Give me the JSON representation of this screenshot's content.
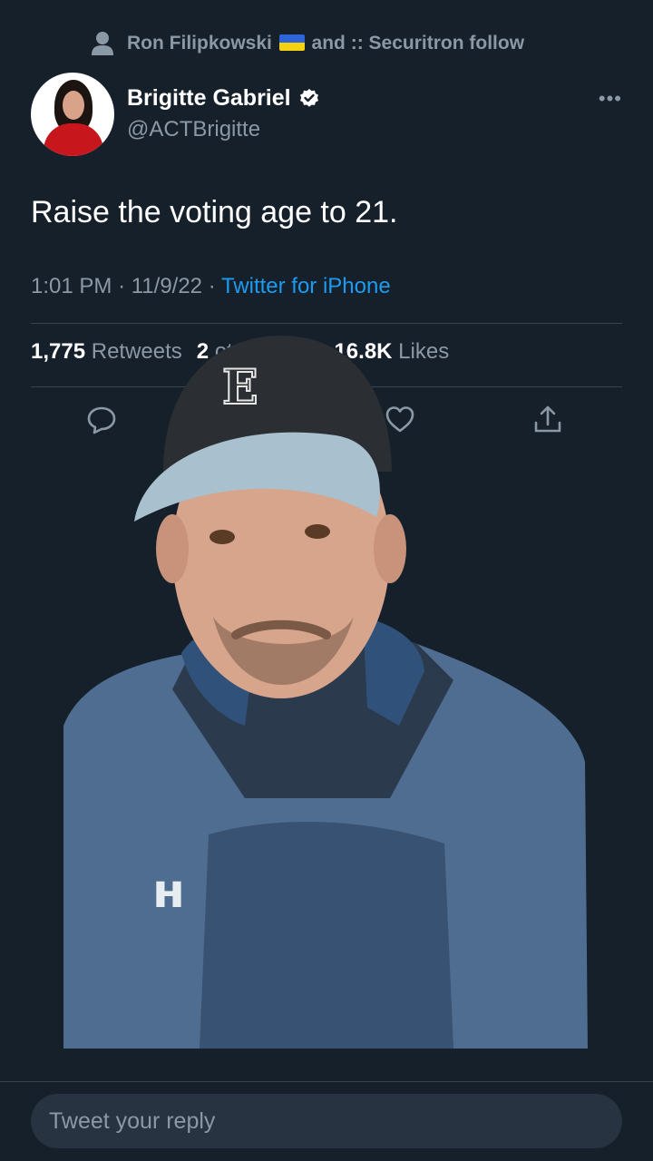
{
  "social_context": {
    "user": "Ron Filipkowski",
    "flag": "ukraine-flag",
    "text": "and :: Securitron follow"
  },
  "author": {
    "display_name": "Brigitte Gabriel",
    "handle": "@ACTBrigitte",
    "verified": true
  },
  "tweet": {
    "text": "Raise the voting age to 21.",
    "time": "1:01 PM",
    "date": "11/9/22",
    "source": "Twitter for iPhone"
  },
  "stats": {
    "retweets_count": "1,775",
    "retweets_label": "Retweets",
    "quotes_count": "2",
    "quotes_label": "ote Tweets",
    "likes_count": "16.8K",
    "likes_label": "Likes"
  },
  "reply": {
    "placeholder": "Tweet your reply"
  },
  "colors": {
    "background": "#15202b",
    "secondary_text": "#8b98a5",
    "link": "#1d9bf0",
    "divider": "#38444d"
  }
}
